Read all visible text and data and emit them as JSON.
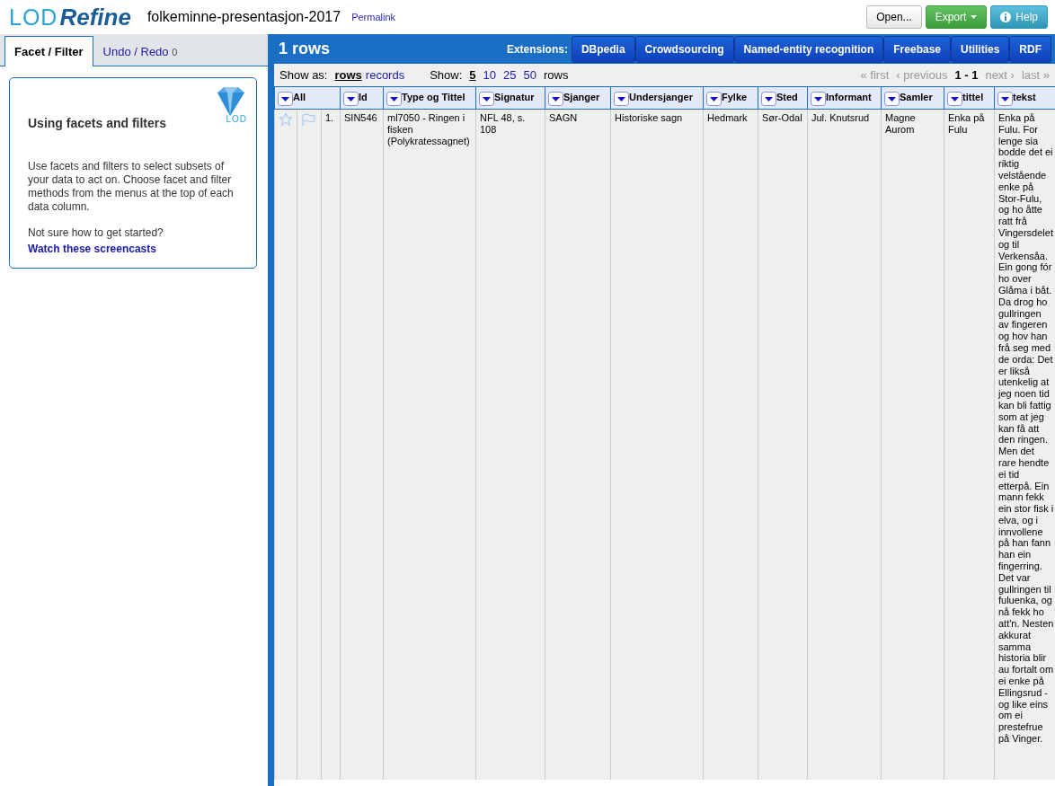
{
  "header": {
    "logo": {
      "part_1": "LOD",
      "part_2": "Refine"
    },
    "project_title": "folkeminne-presentasjon-2017",
    "permalink": "Permalink",
    "buttons": [
      {
        "label": "Open...",
        "kind": "default"
      },
      {
        "label": "Export",
        "kind": "export"
      },
      {
        "label": "Help",
        "kind": "help"
      }
    ]
  },
  "left_panel": {
    "tabs": [
      {
        "label": "Facet / Filter",
        "selected": true
      },
      {
        "label": "Undo / Redo",
        "count": "0",
        "selected": false
      }
    ],
    "help_card": {
      "badge": "LOD",
      "title": "Using facets and filters",
      "body": "Use facets and filters to select subsets of your data to act on. Choose facet and filter methods from the menus at the top of each data column.",
      "question": "Not sure how to get started?",
      "link": "Watch these screencasts"
    }
  },
  "grid": {
    "title": "1 rows",
    "extensions_label": "Extensions:",
    "extensions": [
      "DBpedia",
      "Crowdsourcing",
      "Named-entity recognition",
      "Freebase",
      "Utilities",
      "RDF"
    ],
    "show_as": {
      "label": "Show as:",
      "options": [
        {
          "label": "rows",
          "selected": true
        },
        {
          "label": "records",
          "selected": false
        }
      ]
    },
    "page_size": {
      "label": "Show:",
      "options": [
        {
          "label": "5",
          "selected": true
        },
        {
          "label": "10",
          "selected": false
        },
        {
          "label": "25",
          "selected": false
        },
        {
          "label": "50",
          "selected": false
        }
      ],
      "suffix": "rows"
    },
    "pager": {
      "links_before": [
        {
          "label": "« first",
          "disabled": true
        },
        {
          "label": "‹ previous",
          "disabled": true
        }
      ],
      "range": "1 - 1",
      "links_after": [
        {
          "label": "next ›",
          "disabled": true
        },
        {
          "label": "last »",
          "disabled": true
        }
      ]
    },
    "columns": [
      "All",
      "Id",
      "Type og Tittel",
      "Signatur",
      "Sjanger",
      "Undersjanger",
      "Fylke",
      "Sted",
      "Informant",
      "Samler",
      "tittel",
      "tekst"
    ],
    "rows": [
      {
        "starred": false,
        "flagged": false,
        "cells": [
          "1.",
          "SIN546",
          "ml7050 - Ringen i fisken (Polykratessagnet)",
          "NFL 48, s. 108",
          "SAGN",
          "Historiske sagn",
          "Hedmark",
          "Sør-Odal",
          "Jul. Knutsrud",
          "Magne Aurom",
          "Enka på Fulu",
          "Enka på Fulu. For lenge sia bodde det ei riktig velstående enke på Stor-Fulu, og ho åtte ratt frå Vingersdelet og til Verkensåa. Ein gong fór ho over Glåma i båt. Da drog ho gullringen av fingeren og hov han frå seg med de orda: Det er likså utenkelig at jeg noen tid kan bli fattig som at jeg kan få att den ringen. Men det rare hendte ei tid etterpå. Ein mann fekk ein stor fisk i elva, og i innvollene på han fann han ein fingerring. Det var gullringen til fuluenka, og nå fekk ho att'n. Nesten akkurat samma historia blir au fortalt om ei enke på Ellingsrud - og like eins om ei prestefrue på Vinger."
        ]
      }
    ]
  }
}
